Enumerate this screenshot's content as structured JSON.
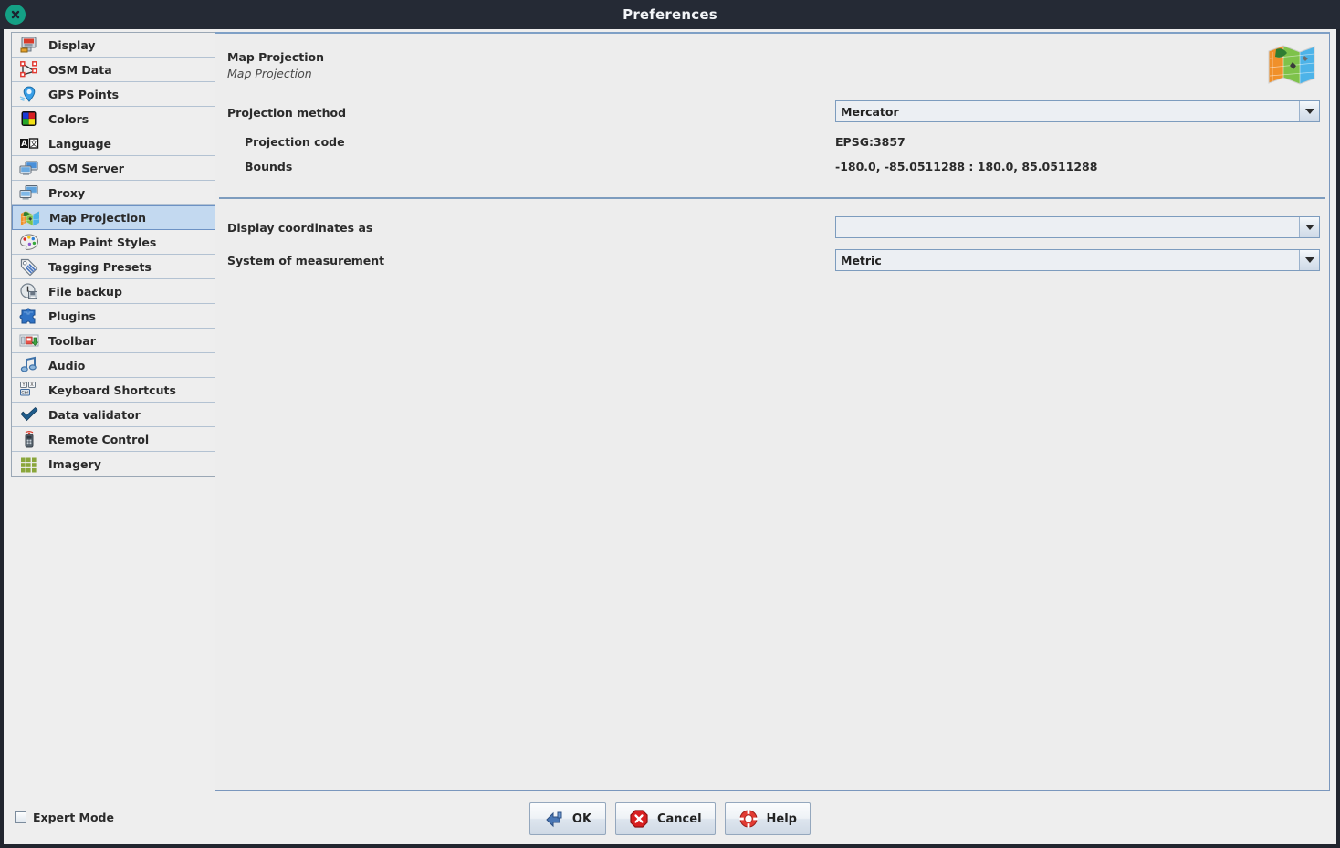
{
  "window": {
    "title": "Preferences",
    "close_icon": "close-icon"
  },
  "sidebar": {
    "items": [
      {
        "label": "Display",
        "icon": "display-icon"
      },
      {
        "label": "OSM Data",
        "icon": "osm-data-icon"
      },
      {
        "label": "GPS Points",
        "icon": "gps-points-icon"
      },
      {
        "label": "Colors",
        "icon": "colors-icon"
      },
      {
        "label": "Language",
        "icon": "language-icon"
      },
      {
        "label": "OSM Server",
        "icon": "osm-server-icon"
      },
      {
        "label": "Proxy",
        "icon": "proxy-icon"
      },
      {
        "label": "Map Projection",
        "icon": "map-projection-icon"
      },
      {
        "label": "Map Paint Styles",
        "icon": "map-paint-styles-icon"
      },
      {
        "label": "Tagging Presets",
        "icon": "tagging-presets-icon"
      },
      {
        "label": "File backup",
        "icon": "file-backup-icon"
      },
      {
        "label": "Plugins",
        "icon": "plugins-icon"
      },
      {
        "label": "Toolbar",
        "icon": "toolbar-icon"
      },
      {
        "label": "Audio",
        "icon": "audio-icon"
      },
      {
        "label": "Keyboard Shortcuts",
        "icon": "keyboard-shortcuts-icon"
      },
      {
        "label": "Data validator",
        "icon": "data-validator-icon"
      },
      {
        "label": "Remote Control",
        "icon": "remote-control-icon"
      },
      {
        "label": "Imagery",
        "icon": "imagery-icon"
      }
    ],
    "selected": "Map Projection"
  },
  "content": {
    "title": "Map Projection",
    "subtitle": "Map Projection",
    "header_icon": "folded-map-icon",
    "projection_method_label": "Projection method",
    "projection_method_value": "Mercator",
    "projection_code_label": "Projection code",
    "projection_code_value": "EPSG:3857",
    "bounds_label": "Bounds",
    "bounds_value": "-180.0, -85.0511288 : 180.0, 85.0511288",
    "display_coordinates_label": "Display coordinates as",
    "display_coordinates_value": "",
    "system_measurement_label": "System of measurement",
    "system_measurement_value": "Metric"
  },
  "footer": {
    "expert_mode_label": "Expert Mode",
    "expert_mode_checked": false,
    "ok_label": "OK",
    "cancel_label": "Cancel",
    "help_label": "Help"
  },
  "colors": {
    "titlebar_bg": "#252a35",
    "close_button": "#14a085",
    "selection_bg": "#c3d9f0",
    "panel_bg": "#ededed",
    "border_blue": "#7d9cbe"
  }
}
